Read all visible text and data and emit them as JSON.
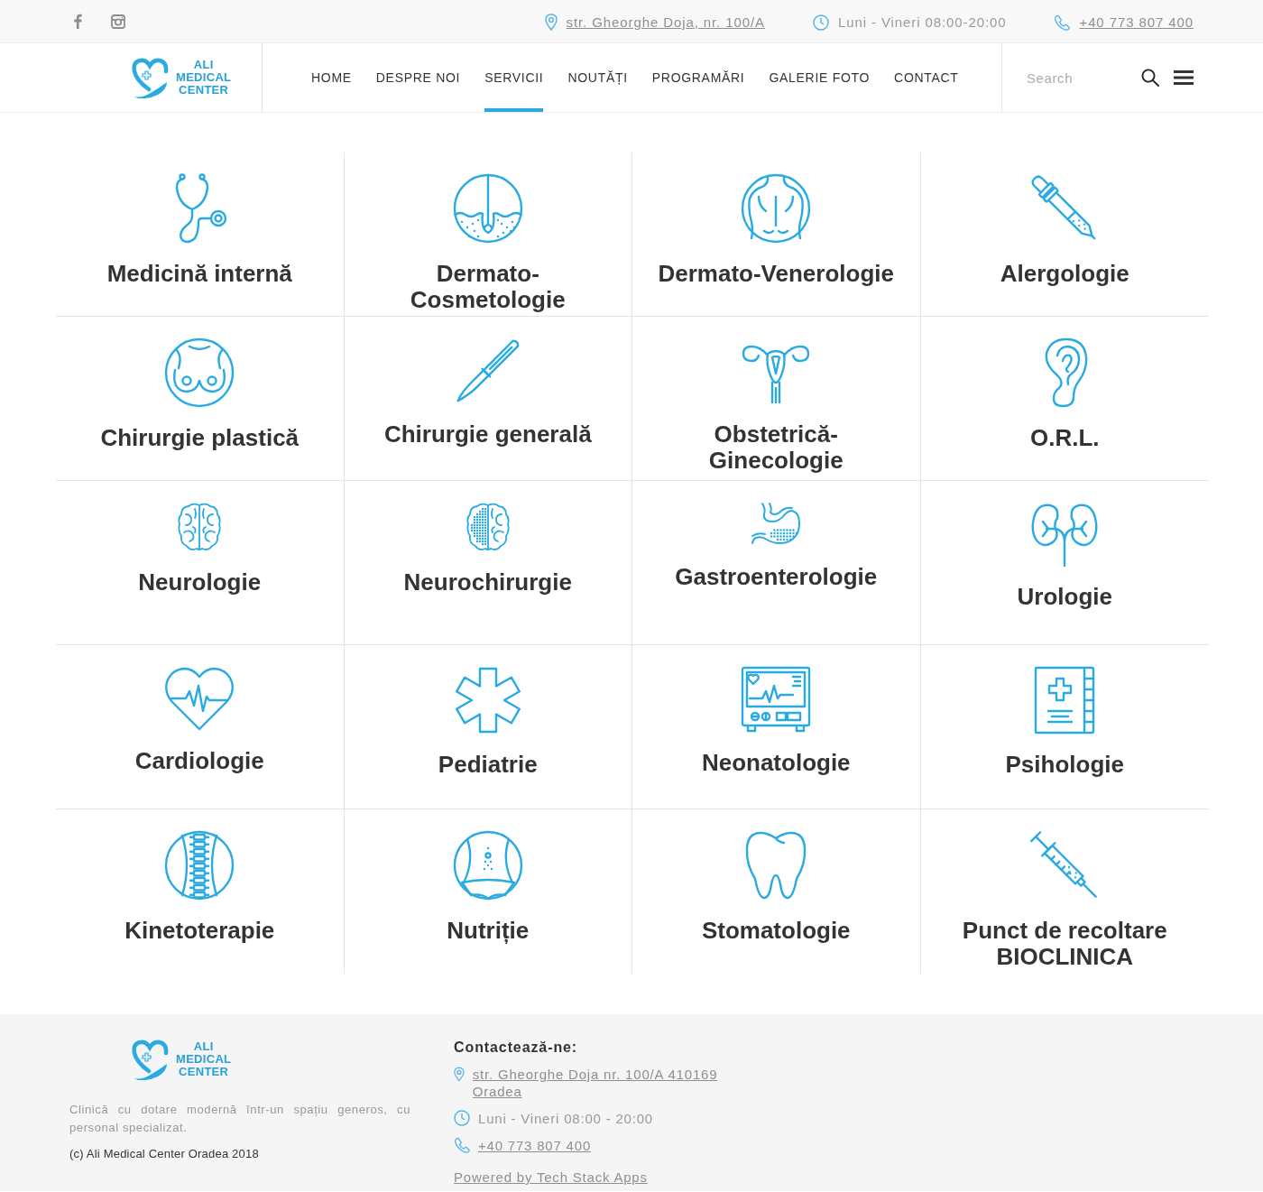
{
  "top_bar": {
    "address": "str. Gheorghe Doja, nr. 100/A",
    "hours": "Luni - Vineri 08:00-20:00",
    "phone": "+40 773 807 400"
  },
  "header": {
    "logo": {
      "lines": [
        "ALI",
        "MEDICAL",
        "CENTER"
      ]
    },
    "nav": [
      {
        "label": "HOME",
        "selected": false
      },
      {
        "label": "DESPRE NOI",
        "selected": false
      },
      {
        "label": "SERVICII",
        "selected": true
      },
      {
        "label": "NOUTĂȚI",
        "selected": false
      },
      {
        "label": "PROGRAMĂRI",
        "selected": false
      },
      {
        "label": "GALERIE FOTO",
        "selected": false
      },
      {
        "label": "CONTACT",
        "selected": false
      }
    ],
    "search": {
      "placeholder": "Search"
    }
  },
  "services": [
    "Medicină internă",
    "Dermato-Cosmetologie",
    "Dermato-Venerologie",
    "Alergologie",
    "Chirurgie plastică",
    "Chirurgie generală",
    "Obstetrică-Ginecologie",
    "O.R.L.",
    "Neurologie",
    "Neurochirurgie",
    "Gastroenterologie",
    "Urologie",
    "Cardiologie",
    "Pediatrie",
    "Neonatologie",
    "Psihologie",
    "Kinetoterapie",
    "Nutriție",
    "Stomatologie",
    "Punct de recoltare BIOCLINICA"
  ],
  "footer": {
    "logo": {
      "lines": [
        "ALI",
        "MEDICAL",
        "CENTER"
      ]
    },
    "about": "Clinică cu dotare modernă într-un spațiu generos, cu personal specializat.",
    "copyright": "(c) Ali Medical Center Oradea 2018",
    "contact": {
      "heading": "Contactează-ne:",
      "address": "str. Gheorghe Doja nr. 100/A 410169 Oradea",
      "hours": "Luni - Vineri 08:00 - 20:00",
      "phone": "+40 773 807 400"
    },
    "credit": "Powered by Tech Stack Apps"
  }
}
